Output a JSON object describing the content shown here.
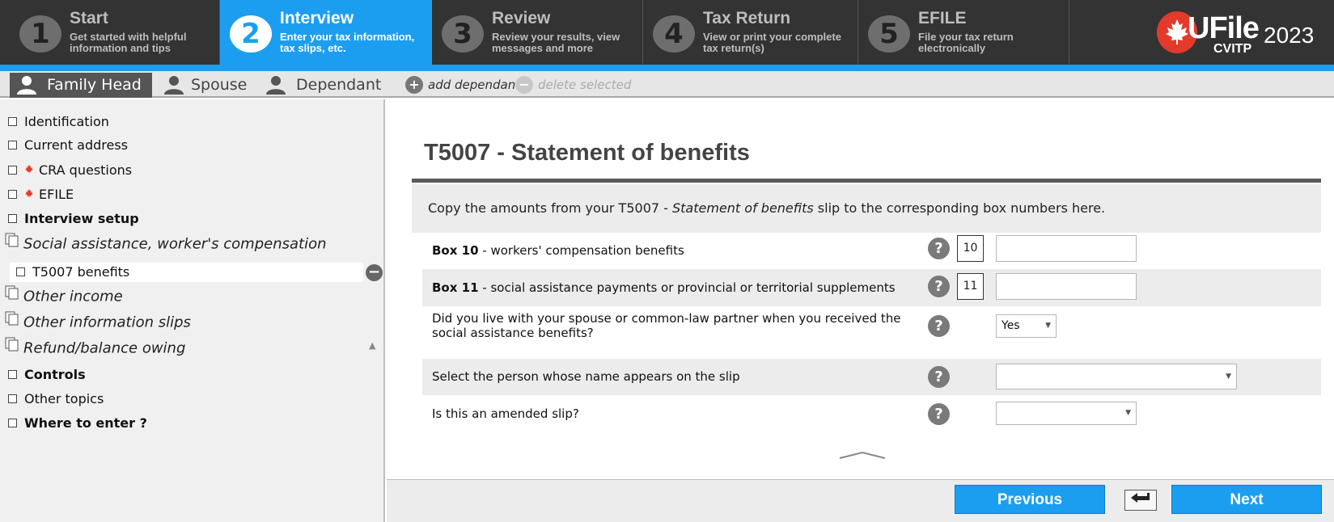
{
  "steps": [
    {
      "num": "1",
      "title": "Start",
      "desc": "Get started with helpful information and tips",
      "active": false
    },
    {
      "num": "2",
      "title": "Interview",
      "desc": "Enter your tax information, tax slips, etc.",
      "active": true
    },
    {
      "num": "3",
      "title": "Review",
      "desc": "Review your results, view messages and more",
      "active": false
    },
    {
      "num": "4",
      "title": "Tax Return",
      "desc": "View or print your complete tax return(s)",
      "active": false
    },
    {
      "num": "5",
      "title": "EFILE",
      "desc": "File your tax return electronically",
      "active": false
    }
  ],
  "logo": {
    "brand": "UFile",
    "year": "2023",
    "sub": "CVITP"
  },
  "person_tabs": {
    "family_head": "Family Head",
    "spouse": "Spouse",
    "dependant": "Dependant",
    "add_dependant": "add dependant",
    "delete_selected": "delete selected"
  },
  "sidebar": {
    "identification": "Identification",
    "current_address": "Current address",
    "cra_questions": "CRA questions",
    "efile": "EFILE",
    "interview_setup": "Interview setup",
    "social_assistance": "Social assistance, worker's compensation",
    "t5007_benefits": "T5007 benefits",
    "other_income": "Other income",
    "other_information_slips": "Other information slips",
    "refund_balance": "Refund/balance owing",
    "controls": "Controls",
    "other_topics": "Other topics",
    "where_to_enter": "Where to enter ?"
  },
  "main": {
    "title": "T5007 - Statement of benefits",
    "intro_prefix": "Copy the amounts from your T5007 - ",
    "intro_em": "Statement of benefits",
    "intro_suffix": " slip to the corresponding box numbers here.",
    "box10_bold": "Box 10",
    "box10_text": " - workers' compensation benefits",
    "box10_num": "10",
    "box10_value": "",
    "box11_bold": "Box 11",
    "box11_text": " - social assistance payments or provincial or territorial supplements",
    "box11_num": "11",
    "box11_value": "",
    "live_with_spouse_label": "Did you live with your spouse or common-law partner when you received the social assistance benefits?",
    "live_with_spouse_value": "Yes",
    "select_person_label": "Select the person whose name appears on the slip",
    "select_person_value": "",
    "amended_label": "Is this an amended slip?",
    "amended_value": "",
    "help_glyph": "?"
  },
  "footer": {
    "previous": "Previous",
    "next": "Next"
  },
  "colors": {
    "accent": "#1c9ef0",
    "topbar": "#333333",
    "maple": "#e23b2c"
  }
}
